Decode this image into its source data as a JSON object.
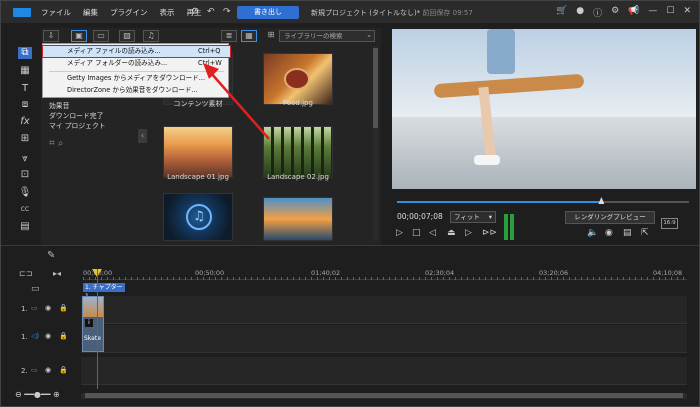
{
  "menu": [
    "ファイル",
    "編集",
    "プラグイン",
    "表示",
    "再生"
  ],
  "toolbar": {
    "export_label": "書き出し"
  },
  "window_title": {
    "project": "新規プロジェクト (タイトルなし)*",
    "save_status": "前回保存 09:57"
  },
  "library": {
    "search_placeholder": "ライブラリーの検索",
    "tree": [
      "効果音",
      "ダウンロード完了",
      "マイ プロジェクト"
    ],
    "media": [
      {
        "label": "コンテンツ素材"
      },
      {
        "label": "Food.jpg"
      },
      {
        "label": "Landscape 01.jpg"
      },
      {
        "label": "Landscape 02.jpg"
      },
      {
        "label": ""
      },
      {
        "label": ""
      }
    ]
  },
  "context_menu": {
    "items": [
      {
        "label": "メディア ファイルの読み込み...",
        "shortcut": "Ctrl+Q"
      },
      {
        "label": "メディア フォルダーの読み込み...",
        "shortcut": "Ctrl+W"
      },
      {
        "label": "Getty Images からメディアをダウンロード...",
        "shortcut": ""
      },
      {
        "label": "DirectorZone から効果音をダウンロード...",
        "shortcut": ""
      }
    ]
  },
  "preview": {
    "timecode": "00;00;07;08",
    "fit_label": "フィット",
    "render_label": "レンダリングプレビュー",
    "ratio_label": "16:9",
    "progress": 0.7
  },
  "timeline": {
    "ruler": [
      "00;00;00",
      "00;50;00",
      "01;40;02",
      "02;30;04",
      "03;20;06",
      "04;10;08"
    ],
    "chapter_label": "1. チャプター 1",
    "tracks": [
      "1.",
      "1.",
      "2."
    ],
    "clip_label": "Skate"
  },
  "colors": {
    "accent": "#2f6fd1",
    "highlight_outline": "#d32020",
    "playhead": "#e03030"
  }
}
